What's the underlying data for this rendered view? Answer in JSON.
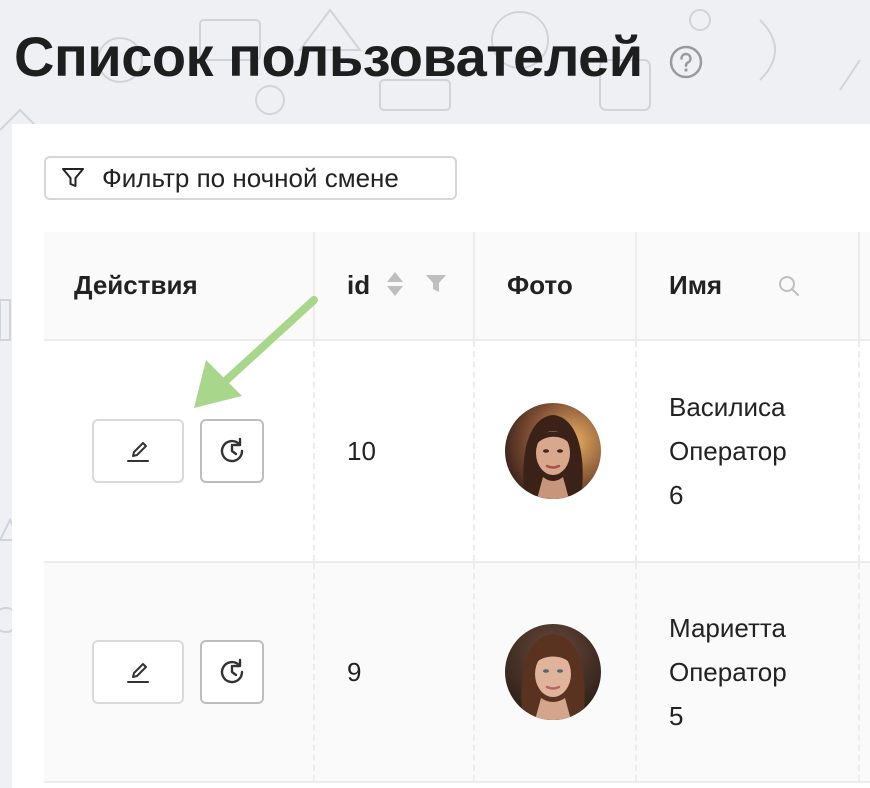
{
  "header": {
    "title": "Список пользователей",
    "help_icon": "question-circle-icon"
  },
  "filter": {
    "label": "Фильтр по ночной смене",
    "icon": "funnel-icon"
  },
  "table": {
    "columns": {
      "actions": "Действия",
      "id": "id",
      "photo": "Фото",
      "name": "Имя"
    },
    "rows": [
      {
        "id": "10",
        "name": "Василиса",
        "role": "Оператор",
        "number": "6",
        "actions": [
          "edit-icon",
          "history-icon"
        ]
      },
      {
        "id": "9",
        "name": "Мариетта",
        "role": "Оператор",
        "number": "5",
        "actions": [
          "edit-icon",
          "history-icon"
        ]
      }
    ]
  },
  "colors": {
    "annotation_arrow": "#a8d68a",
    "border": "#d9d9d9",
    "header_bg": "#fafafa",
    "page_bg": "#eef0f3"
  }
}
